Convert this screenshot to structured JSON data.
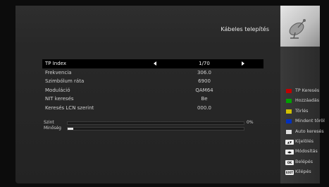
{
  "header": {
    "title": "Kábeles telepítés"
  },
  "rows": [
    {
      "label": "TP Index",
      "value": "1/70"
    },
    {
      "label": "Frekvencia",
      "value": "306.0"
    },
    {
      "label": "Szimbólum ráta",
      "value": "6900"
    },
    {
      "label": "Moduláció",
      "value": "QAM64"
    },
    {
      "label": "NIT keresés",
      "value": "Be"
    },
    {
      "label": "Keresés LCN szerint",
      "value": "000.0"
    }
  ],
  "signal": {
    "level_label": "Szint",
    "level_value": 0,
    "level_text": "0%",
    "quality_label": "Minőség",
    "quality_value": 0.03
  },
  "legend": [
    {
      "key": "red",
      "color": "#c00000",
      "label": "TP Keresés"
    },
    {
      "key": "green",
      "color": "#00a000",
      "label": "Hozzáadás"
    },
    {
      "key": "yellow",
      "color": "#d0c000",
      "label": "Törlés"
    },
    {
      "key": "blue",
      "color": "#0030c0",
      "label": "Mindent töröl"
    },
    {
      "key": "white",
      "color": "#e0e0e0",
      "label": "Auto keresés"
    },
    {
      "key": "nav-icon",
      "label": "Kijelölés"
    },
    {
      "key": "lr-icon",
      "label": "Módosítás"
    },
    {
      "key": "ok-icon",
      "key_text": "OK",
      "label": "Belépés"
    },
    {
      "key": "exit-icon",
      "key_text": "EXIT",
      "label": "Kilépés"
    }
  ]
}
